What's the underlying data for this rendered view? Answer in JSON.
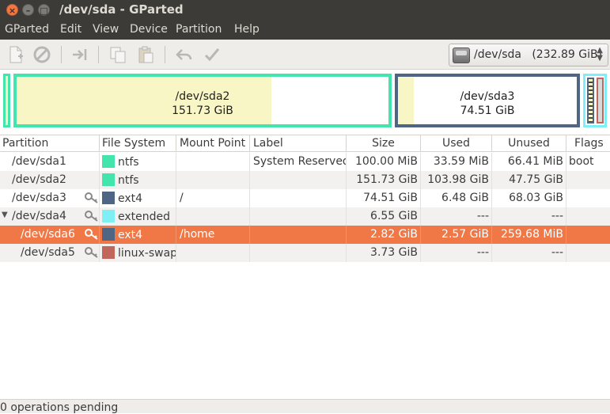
{
  "window": {
    "title": "/dev/sda - GParted"
  },
  "menu": {
    "items": [
      "GParted",
      "Edit",
      "View",
      "Device",
      "Partition",
      "Help"
    ]
  },
  "toolbar": {
    "icons": [
      "new-icon",
      "delete-icon",
      "resize-icon",
      "copy-icon",
      "paste-icon",
      "undo-icon",
      "apply-icon"
    ],
    "device": "/dev/sda   (232.89 GiB)"
  },
  "diskmap": {
    "sda2": {
      "name": "/dev/sda2",
      "size": "151.73 GiB",
      "used_fraction": 0.685
    },
    "sda3": {
      "name": "/dev/sda3",
      "size": "74.51 GiB",
      "used_fraction": 0.087
    }
  },
  "table": {
    "headers": [
      "Partition",
      "File System",
      "Mount Point",
      "Label",
      "Size",
      "Used",
      "Unused",
      "Flags"
    ],
    "rows": [
      {
        "partition": "/dev/sda1",
        "fs": "ntfs",
        "fs_color": "#42e5ac",
        "mount": "",
        "label": "System Reserved",
        "size": "100.00 MiB",
        "used": "33.59 MiB",
        "unused": "66.41 MiB",
        "flags": "boot"
      },
      {
        "partition": "/dev/sda2",
        "fs": "ntfs",
        "fs_color": "#42e5ac",
        "mount": "",
        "label": "",
        "size": "151.73 GiB",
        "used": "103.98 GiB",
        "unused": "47.75 GiB",
        "flags": ""
      },
      {
        "partition": "/dev/sda3",
        "fs": "ext4",
        "fs_color": "#4f6584",
        "mount": "/",
        "label": "",
        "size": "74.51 GiB",
        "used": "6.48 GiB",
        "unused": "68.03 GiB",
        "flags": ""
      },
      {
        "partition": "/dev/sda4",
        "fs": "extended",
        "fs_color": "#7ef0f5",
        "mount": "",
        "label": "",
        "size": "6.55 GiB",
        "used": "---",
        "unused": "---",
        "flags": ""
      },
      {
        "partition": "/dev/sda6",
        "fs": "ext4",
        "fs_color": "#4f6584",
        "mount": "/home",
        "label": "",
        "size": "2.82 GiB",
        "used": "2.57 GiB",
        "unused": "259.68 MiB",
        "flags": ""
      },
      {
        "partition": "/dev/sda5",
        "fs": "linux-swap",
        "fs_color": "#c1665a",
        "mount": "",
        "label": "",
        "size": "3.73 GiB",
        "used": "---",
        "unused": "---",
        "flags": ""
      }
    ]
  },
  "status": {
    "text": "0 operations pending"
  }
}
